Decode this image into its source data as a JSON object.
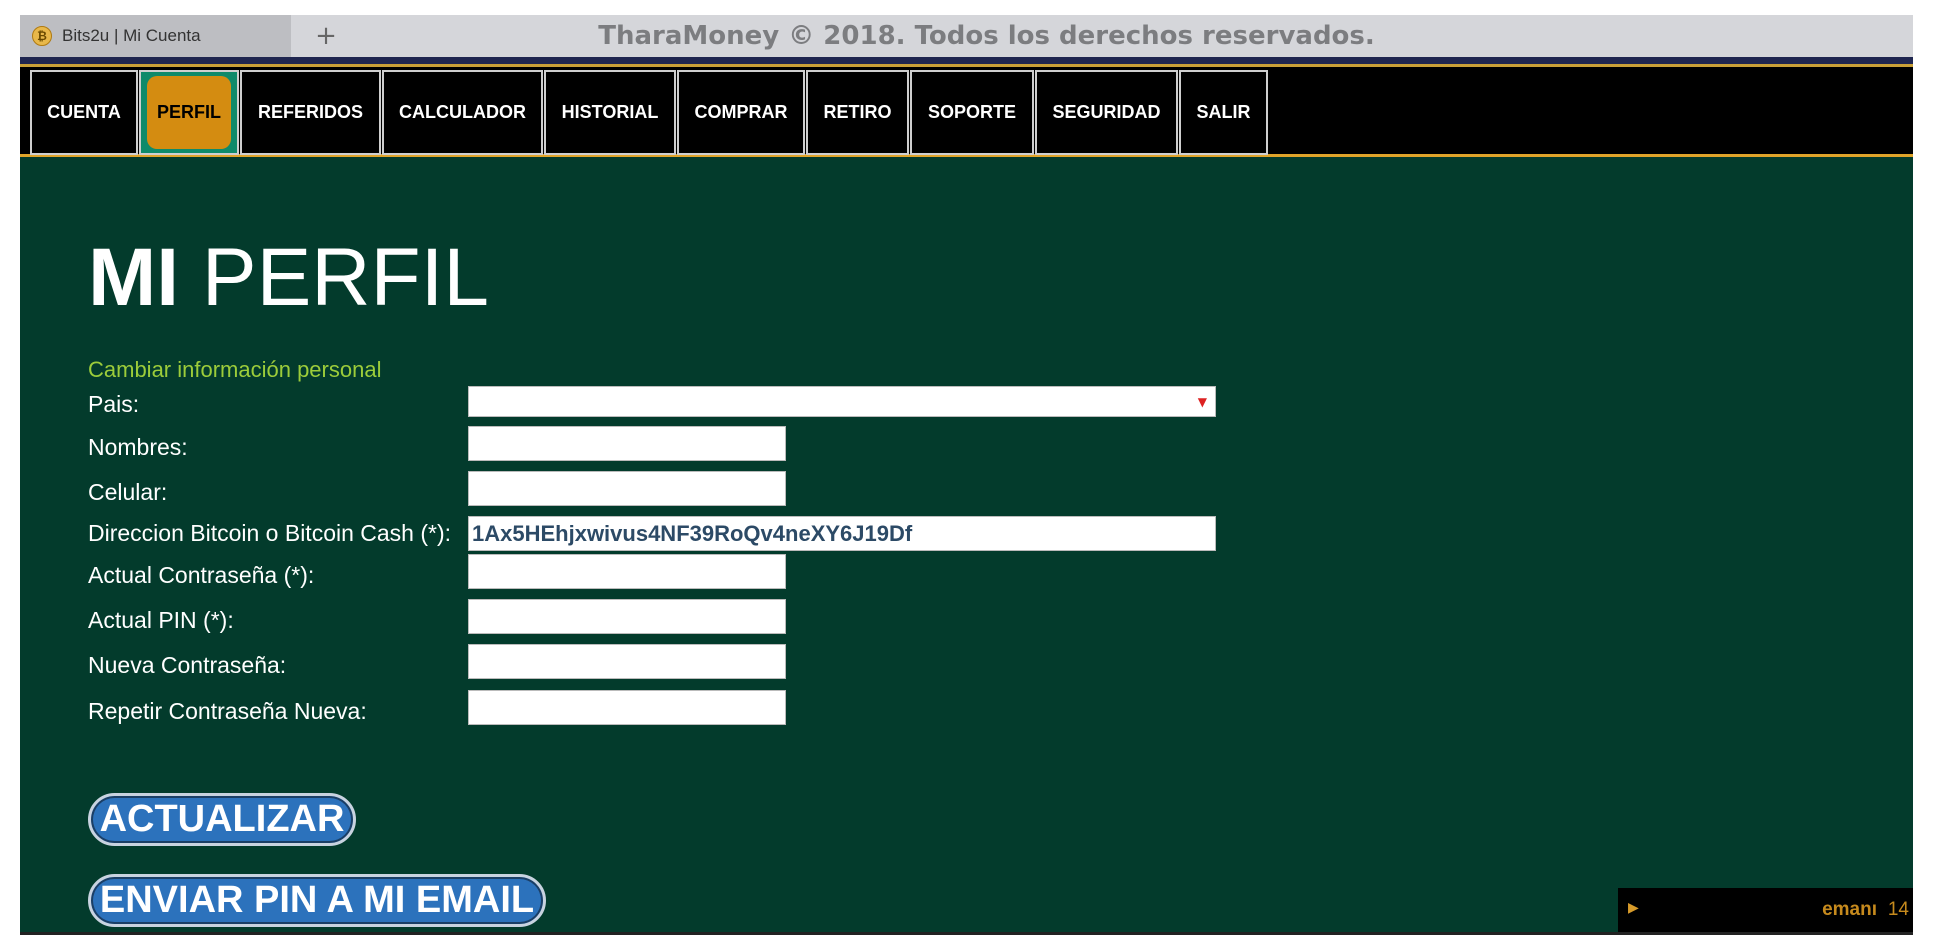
{
  "browser": {
    "tab_title": "Bits2u | Mi Cuenta",
    "favicon": "bitcoin-icon",
    "new_tab": "+",
    "page_heading": "TharaMoney © 2018. Todos los derechos reservados."
  },
  "nav": {
    "items": [
      {
        "label": "CUENTA"
      },
      {
        "label": "PERFIL",
        "active": true
      },
      {
        "label": "REFERIDOS"
      },
      {
        "label": "CALCULADOR"
      },
      {
        "label": "HISTORIAL"
      },
      {
        "label": "COMPRAR"
      },
      {
        "label": "RETIRO"
      },
      {
        "label": "SOPORTE"
      },
      {
        "label": "SEGURIDAD"
      },
      {
        "label": "SALIR"
      }
    ]
  },
  "main": {
    "title_bold": "MI",
    "title_rest": "PERFIL",
    "subtitle": "Cambiar información personal",
    "fields": [
      {
        "label": "Pais:",
        "value": ""
      },
      {
        "label": "Nombres:",
        "value": ""
      },
      {
        "label": "Celular:",
        "value": ""
      },
      {
        "label": "Direccion Bitcoin o Bitcoin Cash (*):",
        "value": "1Ax5HEhjxwivus4NF39RoQv4neXY6J19Df"
      },
      {
        "label": "Actual Contraseña (*):",
        "value": ""
      },
      {
        "label": "Actual PIN (*):",
        "value": ""
      },
      {
        "label": "Nueva Contraseña:",
        "value": ""
      },
      {
        "label": "Repetir Contraseña Nueva:",
        "value": ""
      }
    ],
    "buttons": {
      "update": "ACTUALIZAR",
      "send_pin": "ENVIAR PIN A MI EMAIL"
    }
  },
  "widget": {
    "user": "emanı",
    "number": "14"
  },
  "colors": {
    "nav_active_bg": "#0f8a6a",
    "nav_active_pill": "#d48c11",
    "main_bg": "#033b2c",
    "subtitle": "#9ccc3a",
    "button_bg": "#2c72bc"
  }
}
